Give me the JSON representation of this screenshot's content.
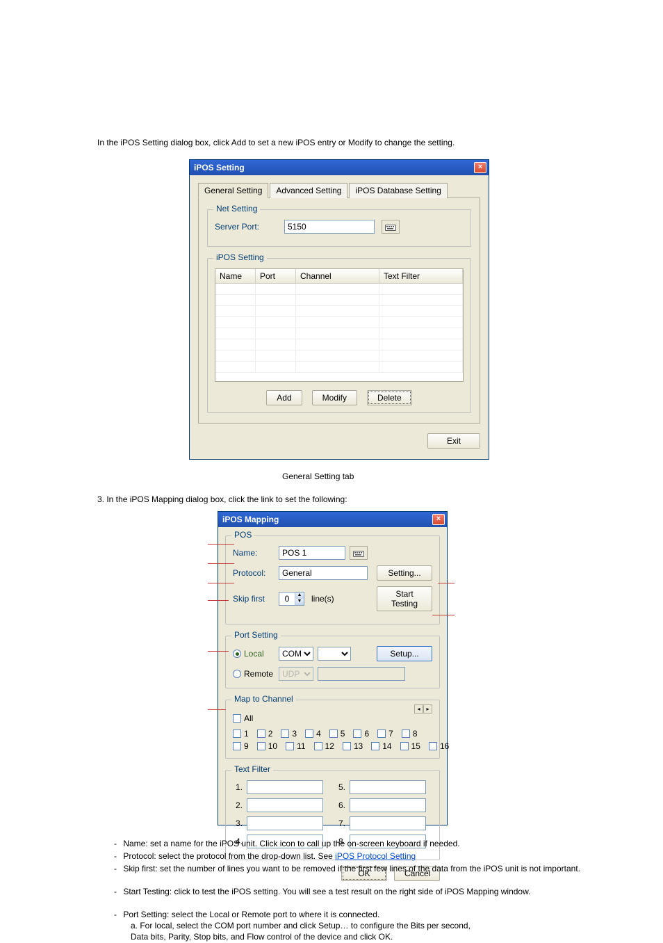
{
  "doc": {
    "intro_line": "In the iPOS Setting dialog box, click Add to set a new iPOS entry or Modify to change the setting.",
    "general_tab_heading": "General Setting tab",
    "desc_tab": "   General Setting tab",
    "callout_after": "3. In the iPOS Mapping dialog box, click the link to set the following:",
    "bul_name": "Name: set a name for the iPOS unit. Click       icon to call up the on-screen keyboard if needed.",
    "bul_proto": "Protocol: select the protocol from the drop-down list. See",
    "bul_proto_link": "iPOS Protocol Setting",
    "bul_skip": "Skip first: set the number of lines you want to be removed if the first few lines of the data from the iPOS unit is not important.",
    "bul_start": "Start Testing: click to test the iPOS setting. You will see a test result on the right side of iPOS Mapping window.",
    "bul_port": "Port Setting: select the Local or Remote port to where it is connected.",
    "bul_port_local1": "a. For local, select the COM port number and click Setup… to configure the Bits per second,",
    "bul_port_local2": "   Data bits, Parity, Stop bits, and Flow control of the device and click OK."
  },
  "dlg1": {
    "title": "iPOS Setting",
    "tabs": [
      "General Setting",
      "Advanced Setting",
      "iPOS Database Setting"
    ],
    "net_setting_legend": "Net Setting",
    "server_port_label": "Server Port:",
    "server_port_value": "5150",
    "ipos_setting_legend": "iPOS Setting",
    "cols": {
      "name": "Name",
      "port": "Port",
      "channel": "Channel",
      "text_filter": "Text Filter"
    },
    "buttons": {
      "add": "Add",
      "modify": "Modify",
      "delete": "Delete",
      "exit": "Exit"
    }
  },
  "dlg2": {
    "title": "iPOS Mapping",
    "pos_legend": "POS",
    "name_label": "Name:",
    "name_value": "POS 1",
    "proto_label": "Protocol:",
    "proto_value": "General",
    "setting_btn": "Setting...",
    "skip_label": "Skip  first",
    "skip_value": "0",
    "lines_label": "line(s)",
    "start_testing_btn": "Start Testing",
    "portset_legend": "Port Setting",
    "local_label": "Local",
    "remote_label": "Remote",
    "com_label": "COM",
    "udp_label": "UDP",
    "setup_btn": "Setup...",
    "map_legend": "Map to Channel",
    "all_label": "All",
    "channels_row1": [
      "1",
      "2",
      "3",
      "4",
      "5",
      "6",
      "7",
      "8"
    ],
    "channels_row2": [
      "9",
      "10",
      "11",
      "12",
      "13",
      "14",
      "15",
      "16"
    ],
    "text_filter_legend": "Text Filter",
    "tf_left": [
      "1.",
      "2.",
      "3.",
      "4."
    ],
    "tf_right": [
      "5.",
      "6.",
      "7.",
      "8."
    ],
    "ok": "OK",
    "cancel": "Cancel"
  }
}
